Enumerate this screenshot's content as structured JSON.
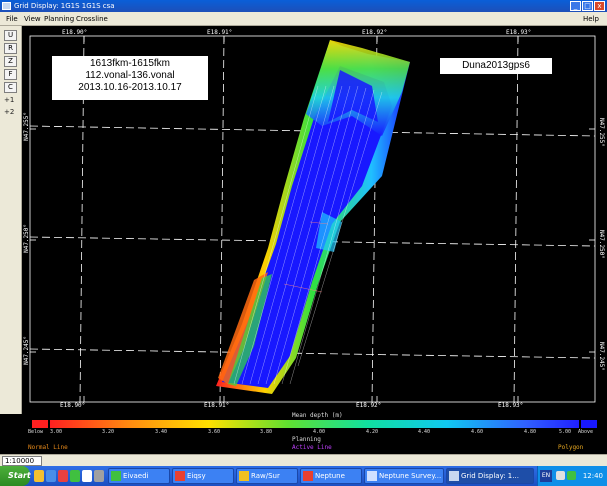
{
  "window": {
    "title": "Grid Display: 1G1S 1G1S csa",
    "buttons": [
      "_",
      "□",
      "x"
    ]
  },
  "menu": {
    "items": [
      "File",
      "View",
      "Planning",
      "Crossline"
    ],
    "help": "Help"
  },
  "toolbar": {
    "tools": [
      "U",
      "R",
      "Z",
      "F",
      "C",
      "+1",
      "+2"
    ]
  },
  "labels": {
    "survey_line1": "1613fkm-1615fkm",
    "survey_line2": "112.vonal-136.vonal",
    "survey_line3": "2013.10.16-2013.10.17",
    "vessel": "Duna2013gps6"
  },
  "coords": {
    "top": [
      "E18.90°",
      "E18.91°",
      "E18.92°",
      "E18.93°"
    ],
    "bottom": [
      "E18.90°",
      "E18.91°",
      "E18.92°",
      "E18.93°"
    ],
    "left": [
      "N47.255°",
      "N47.250°",
      "N47.245°"
    ],
    "right": [
      "N47.255°",
      "N47.250°",
      "N47.245°"
    ]
  },
  "legend": {
    "title": "Mean depth (m)",
    "subtitle": "Planning",
    "below": "Below",
    "above": "Above",
    "ticks": [
      "3.00",
      "3.20",
      "3.40",
      "3.60",
      "3.80",
      "4.00",
      "4.20",
      "4.40",
      "4.60",
      "4.80",
      "5.00"
    ],
    "line_labels": [
      {
        "text": "Normal Line",
        "color": "#e88a1a"
      },
      {
        "text": "Active Line",
        "color": "#c040ff"
      },
      {
        "text": "Polygon",
        "color": "#e8a820"
      }
    ],
    "colors": {
      "below": "#ff2020",
      "above": "#1818ff"
    }
  },
  "status": {
    "scale": "1:10000"
  },
  "taskbar": {
    "start": "Start",
    "tasks": [
      {
        "label": "Eivaedi",
        "active": false
      },
      {
        "label": "Eiqsy",
        "active": false
      },
      {
        "label": "Raw/Sur",
        "active": false
      },
      {
        "label": "Neptune",
        "active": false
      },
      {
        "label": "Neptune Survey...",
        "active": false
      },
      {
        "label": "Grid Display: 1...",
        "active": true
      }
    ],
    "lang": "EN",
    "clock": "12:40"
  }
}
